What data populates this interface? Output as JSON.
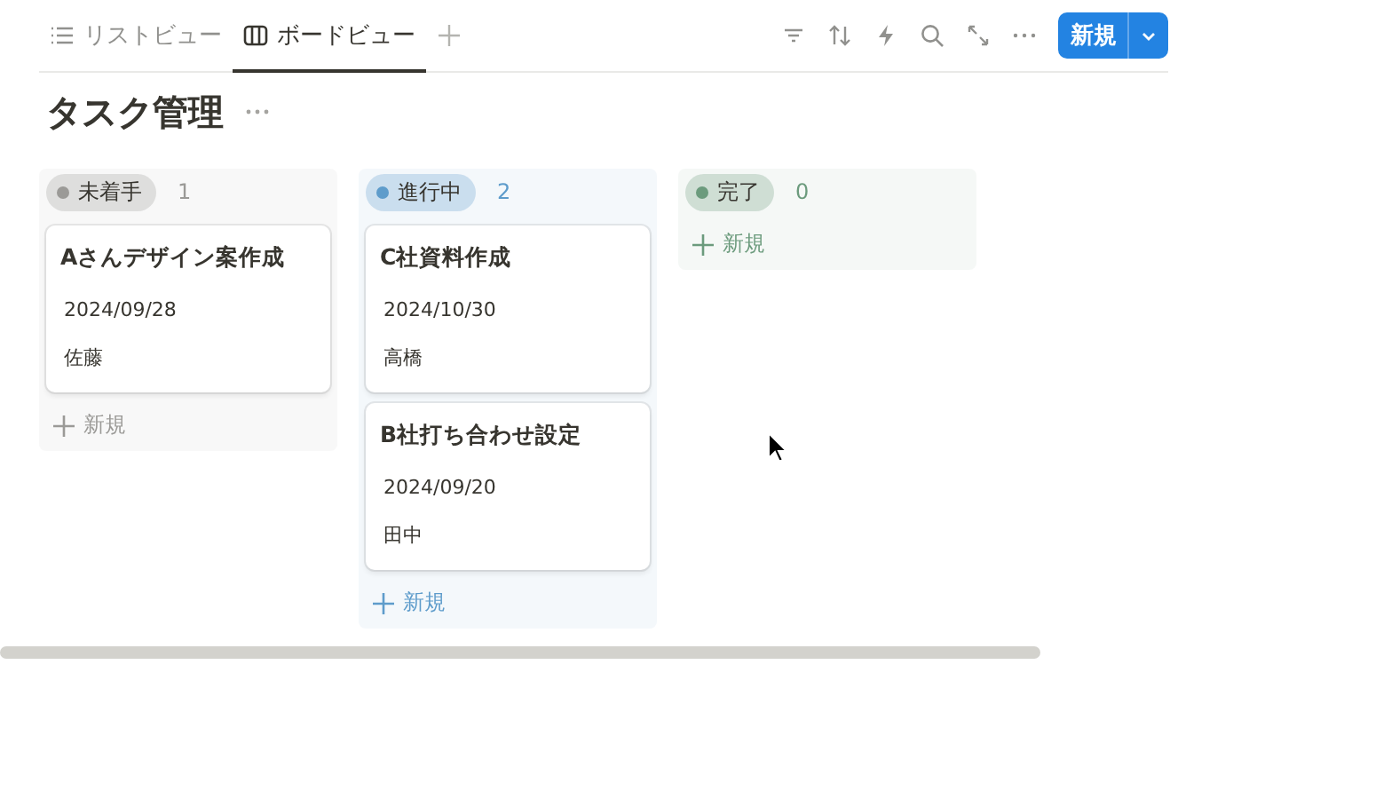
{
  "tabs": [
    {
      "label": "リストビュー",
      "kind": "list",
      "selected": false
    },
    {
      "label": "ボードビュー",
      "kind": "board",
      "selected": true
    }
  ],
  "toolbar": {
    "new_button": "新規"
  },
  "title": "タスク管理",
  "columns": [
    {
      "name": "未着手",
      "count": "1",
      "color": "#9b9a97",
      "add_label": "新規",
      "cards": [
        {
          "title": "Aさんデザイン案作成",
          "date": "2024/09/28",
          "assignee": "佐藤"
        }
      ]
    },
    {
      "name": "進行中",
      "count": "2",
      "color": "#5e9ccb",
      "add_label": "新規",
      "cards": [
        {
          "title": "C社資料作成",
          "date": "2024/10/30",
          "assignee": "高橋"
        },
        {
          "title": "B社打ち合わせ設定",
          "date": "2024/09/20",
          "assignee": "田中"
        }
      ]
    },
    {
      "name": "完了",
      "count": "0",
      "color": "#6c9b7d",
      "add_label": "新規"
    }
  ]
}
